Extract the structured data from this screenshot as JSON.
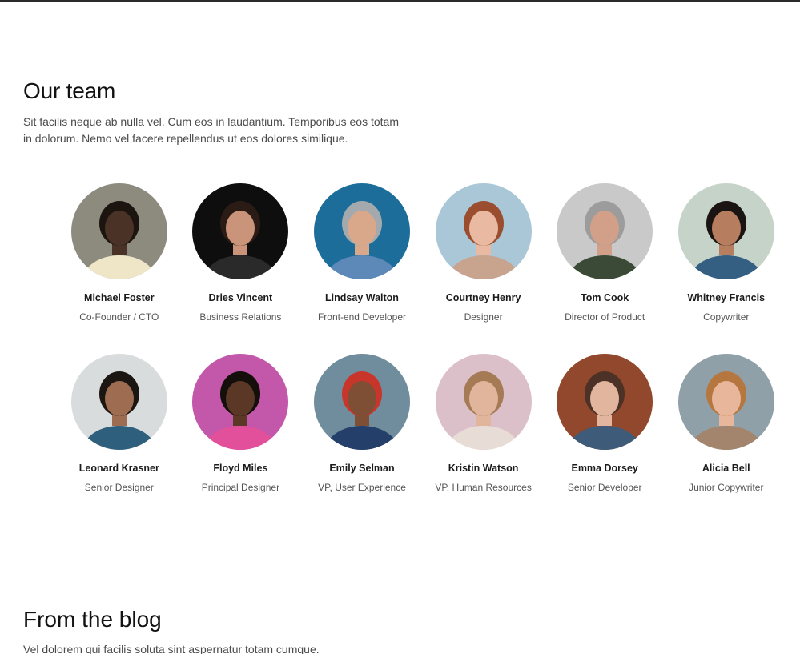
{
  "team": {
    "title": "Our team",
    "description": "Sit facilis neque ab nulla vel. Cum eos in laudantium. Temporibus eos totam in dolorum. Nemo vel facere repellendus ut eos dolores similique.",
    "members": [
      {
        "name": "Michael Foster",
        "role": "Co-Founder / CTO",
        "bg": "#8d8a7e",
        "skin": "#4a3326",
        "hair": "#1b140f",
        "shirt": "#efe6c8"
      },
      {
        "name": "Dries Vincent",
        "role": "Business Relations",
        "bg": "#0e0e0e",
        "skin": "#c99479",
        "hair": "#2a1c14",
        "shirt": "#2a2a2a"
      },
      {
        "name": "Lindsay Walton",
        "role": "Front-end Developer",
        "bg": "#1c6d9a",
        "skin": "#d9a88b",
        "hair": "#a4a9ad",
        "shirt": "#5d89b8"
      },
      {
        "name": "Courtney Henry",
        "role": "Designer",
        "bg": "#a9c7d6",
        "skin": "#eab9a2",
        "hair": "#9b4e2f",
        "shirt": "#c8a48f"
      },
      {
        "name": "Tom Cook",
        "role": "Director of Product",
        "bg": "#c9c9c9",
        "skin": "#d2a089",
        "hair": "#9c9c9c",
        "shirt": "#3b4a36"
      },
      {
        "name": "Whitney Francis",
        "role": "Copywriter",
        "bg": "#c6d3c8",
        "skin": "#b77d5f",
        "hair": "#1a1512",
        "shirt": "#355e83"
      },
      {
        "name": "Leonard Krasner",
        "role": "Senior Designer",
        "bg": "#d9dcdc",
        "skin": "#9e6c51",
        "hair": "#1c1612",
        "shirt": "#2e5f7d"
      },
      {
        "name": "Floyd Miles",
        "role": "Principal Designer",
        "bg": "#c357a9",
        "skin": "#5a3825",
        "hair": "#140f0b",
        "shirt": "#e24f9a"
      },
      {
        "name": "Emily Selman",
        "role": "VP, User Experience",
        "bg": "#6f8d9c",
        "skin": "#7e4e35",
        "hair": "#c8362b",
        "shirt": "#233f6a"
      },
      {
        "name": "Kristin Watson",
        "role": "VP, Human Resources",
        "bg": "#dcc0c9",
        "skin": "#e1b59c",
        "hair": "#a47b55",
        "shirt": "#e8dcd6"
      },
      {
        "name": "Emma Dorsey",
        "role": "Senior Developer",
        "bg": "#92482c",
        "skin": "#e2b69e",
        "hair": "#4c3226",
        "shirt": "#3e5b7a"
      },
      {
        "name": "Alicia Bell",
        "role": "Junior Copywriter",
        "bg": "#8fa0a8",
        "skin": "#e7b69b",
        "hair": "#b5773f",
        "shirt": "#a2856c"
      }
    ]
  },
  "blog": {
    "title": "From the blog",
    "description": "Vel dolorem qui facilis soluta sint aspernatur totam cumque."
  }
}
